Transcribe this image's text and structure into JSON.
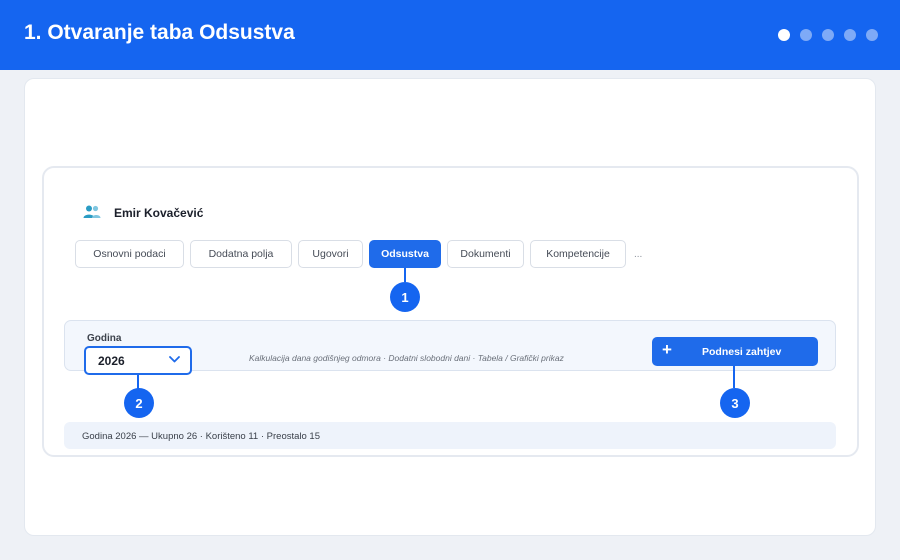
{
  "header": {
    "title": "1. Otvaranje taba Odsustva",
    "steps_total": 5,
    "active_step": 1
  },
  "person": {
    "name": "Emir Kovačević",
    "icon": "users-icon"
  },
  "tabs": [
    {
      "label": "Osnovni podaci",
      "active": false
    },
    {
      "label": "Dodatna polja",
      "active": false
    },
    {
      "label": "Ugovori",
      "active": false
    },
    {
      "label": "Odsustva",
      "active": true
    },
    {
      "label": "Dokumenti",
      "active": false
    },
    {
      "label": "Kompetencije",
      "active": false
    }
  ],
  "tabs_more": "...",
  "markers": {
    "m1": "1",
    "m2": "2",
    "m3": "3"
  },
  "filter": {
    "year_label": "Godina",
    "year_value": "2026",
    "hint": "Kalkulacija dana godišnjeg odmora · Dodatni slobodni dani · Tabela / Grafički prikaz"
  },
  "submit": {
    "icon": "plus-icon",
    "label": "Podnesi zahtjev"
  },
  "summary": {
    "text": "Godina 2026 — Ukupno 26 · Korišteno 11 · Preostalo 15"
  },
  "colors": {
    "accent": "#1565f0",
    "button": "#1f6bea",
    "toolbar_bg": "#f3f7fd",
    "summary_bg": "#eef3fb"
  }
}
